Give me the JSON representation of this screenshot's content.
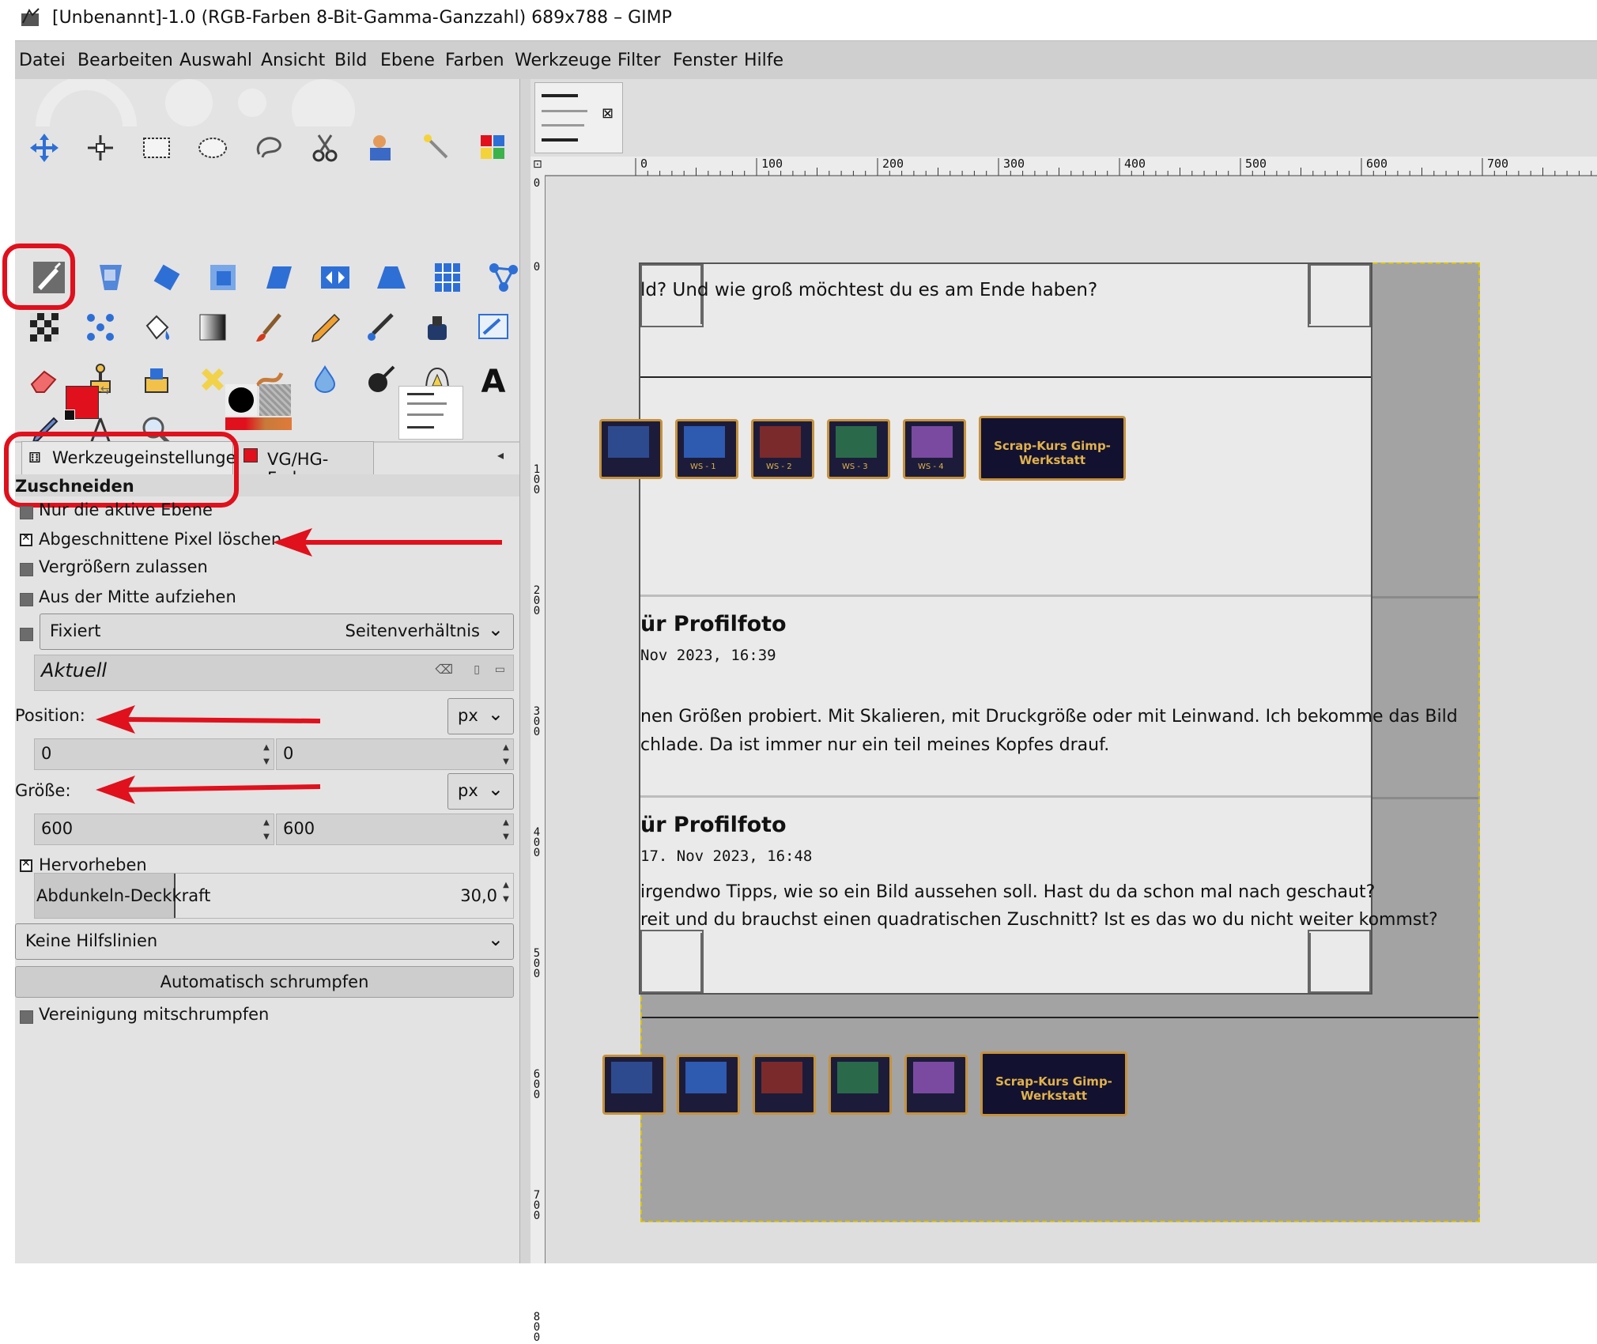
{
  "window": {
    "title": "[Unbenannt]-1.0 (RGB-Farben 8-Bit-Gamma-Ganzzahl) 689x788 – GIMP"
  },
  "menubar": {
    "items": [
      "Datei",
      "Bearbeiten",
      "Auswahl",
      "Ansicht",
      "Bild",
      "Ebene",
      "Farben",
      "Werkzeuge",
      "Filter",
      "Fenster",
      "Hilfe"
    ]
  },
  "toolbox": {
    "rows": [
      [
        "move-tool-icon",
        "align-tool-icon",
        "rect-select-tool-icon",
        "ellipse-select-tool-icon",
        "free-select-tool-icon",
        "scissors-select-tool-icon",
        "foreground-select-tool-icon",
        "fuzzy-select-tool-icon",
        "color-select-tool-icon"
      ],
      [
        "crop-tool-icon",
        "unified-transform-tool-icon",
        "rotate-tool-icon",
        "scale-tool-icon",
        "shear-tool-icon",
        "flip-tool-icon",
        "perspective-tool-icon",
        "cage-transform-tool-icon",
        "handle-transform-tool-icon"
      ],
      [
        "checker-tool-icon",
        "warp-tool-icon",
        "bucket-fill-tool-icon",
        "gradient-tool-icon",
        "paintbrush-tool-icon",
        "pencil-tool-icon",
        "airbrush-tool-icon",
        "ink-tool-icon",
        "mypaint-brush-tool-icon"
      ],
      [
        "eraser-tool-icon",
        "clone-tool-icon",
        "heal-tool-icon",
        "perspective-clone-tool-icon",
        "smudge-tool-icon",
        "blur-tool-icon",
        "dodge-burn-tool-icon",
        "paths-tool-icon",
        "text-tool-icon"
      ],
      [
        "color-picker-tool-icon",
        "measure-tool-icon",
        "zoom-tool-icon"
      ]
    ],
    "active_tool": "crop-tool-icon"
  },
  "colors": {
    "foreground": "#e0101c",
    "background": "#ffffff",
    "accent_red": "#e0101c"
  },
  "dock": {
    "tab_tool_options": "Werkzeugeinstellungen",
    "tab_fg_bg": "VG/HG-Farbe"
  },
  "tool_options": {
    "title": "Zuschneiden",
    "options": [
      {
        "label": "Nur die aktive Ebene",
        "checked": false
      },
      {
        "label": "Abgeschnittene Pixel löschen",
        "checked": true
      },
      {
        "label": "Vergrößern zulassen",
        "checked": false
      },
      {
        "label": "Aus der Mitte aufziehen",
        "checked": false
      }
    ],
    "fixed_label": "Fixiert",
    "fixed_mode": "Seitenverhältnis",
    "fixed_value": "Aktuell",
    "position_label": "Position:",
    "position_unit": "px",
    "position_x": "0",
    "position_y": "0",
    "size_label": "Größe:",
    "size_unit": "px",
    "size_w": "600",
    "size_h": "600",
    "highlight_label": "Hervorheben",
    "highlight_checked": true,
    "opacity_label": "Abdunkeln-Deckkraft",
    "opacity_value": "30,0",
    "guides": "Keine Hilfslinien",
    "auto_shrink": "Automatisch schrumpfen",
    "shrink_merged_label": "Vereinigung mitschrumpfen",
    "shrink_merged_checked": false
  },
  "rulers": {
    "h_labels": [
      "0",
      "100",
      "200",
      "300",
      "400",
      "500",
      "600",
      "700"
    ],
    "v_labels": [
      "0",
      "0",
      "100",
      "200",
      "300",
      "400",
      "500",
      "600",
      "700",
      "800"
    ]
  },
  "canvas": {
    "line1": "ld? Und wie groß möchtest du es am Ende haben?",
    "heading1": "ür Profilfoto",
    "date1": "Nov 2023, 16:39",
    "body1a": "nen Größen probiert. Mit Skalieren, mit Druckgröße oder mit Leinwand. Ich bekomme das Bild",
    "body1b": "chlade. Da ist immer nur ein teil meines Kopfes drauf.",
    "heading2": "ür Profilfoto",
    "date2": "17. Nov 2023, 16:48",
    "body2a": "irgendwo Tipps, wie so ein Bild aussehen soll. Hast du da schon mal nach geschaut?",
    "body2b": "reit und du brauchst einen quadratischen Zuschnitt? Ist es das wo du nicht weiter kommst?",
    "train_wagons": [
      "WS - 1",
      "WS - 2",
      "WS - 3",
      "WS - 4"
    ],
    "train_loco": "Scrap-Kurs Gimp-Werkstatt"
  }
}
